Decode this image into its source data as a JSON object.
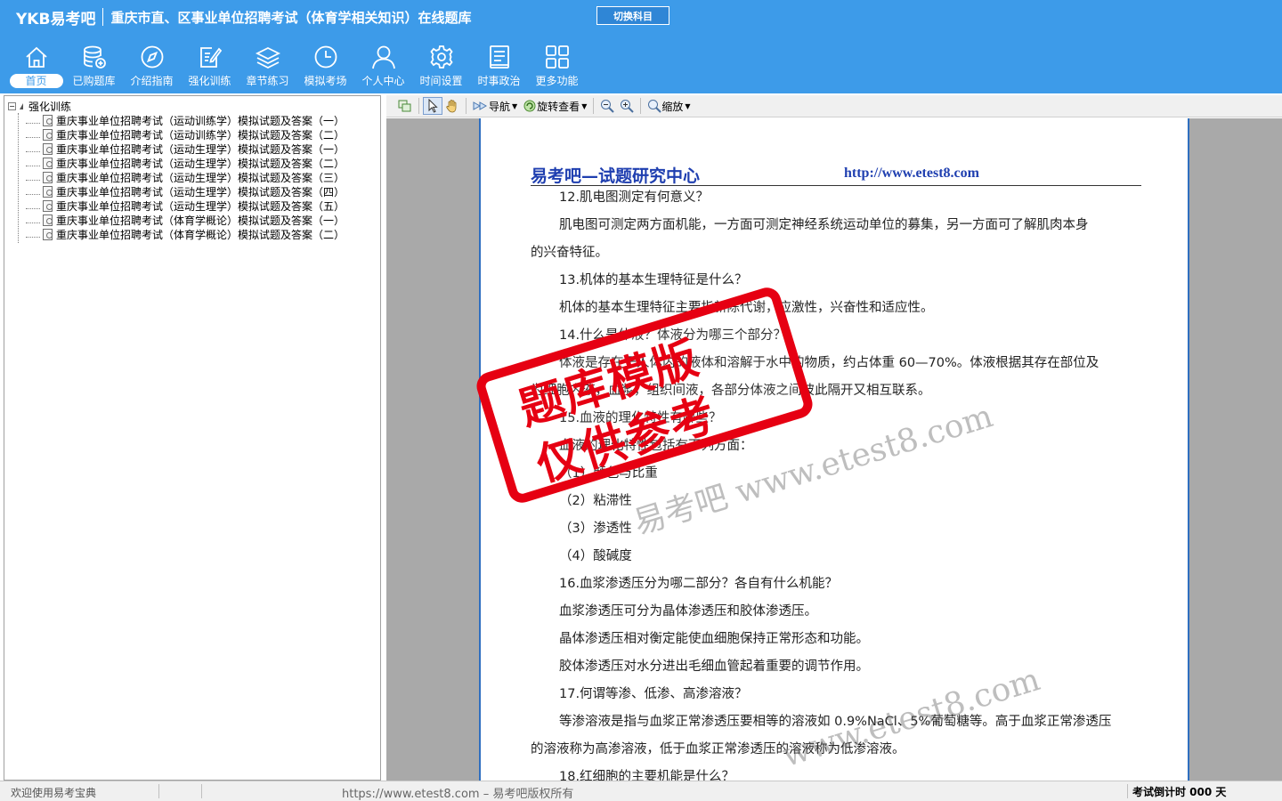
{
  "header": {
    "logo": "YKB易考吧",
    "title": "重庆市直、区事业单位招聘考试（体育学相关知识）在线题库",
    "switch_label": "切换科目"
  },
  "nav": [
    {
      "label": "首页",
      "icon": "home-icon"
    },
    {
      "label": "已购题库",
      "icon": "database-icon"
    },
    {
      "label": "介绍指南",
      "icon": "compass-icon"
    },
    {
      "label": "强化训练",
      "icon": "edit-icon"
    },
    {
      "label": "章节练习",
      "icon": "layers-icon"
    },
    {
      "label": "模拟考场",
      "icon": "clock-icon"
    },
    {
      "label": "个人中心",
      "icon": "user-icon"
    },
    {
      "label": "时间设置",
      "icon": "gear-icon"
    },
    {
      "label": "时事政治",
      "icon": "news-icon"
    },
    {
      "label": "更多功能",
      "icon": "grid-icon"
    }
  ],
  "tree": {
    "root": "强化训练",
    "items": [
      "重庆事业单位招聘考试（运动训练学）模拟试题及答案（一）",
      "重庆事业单位招聘考试（运动训练学）模拟试题及答案（二）",
      "重庆事业单位招聘考试（运动生理学）模拟试题及答案（一）",
      "重庆事业单位招聘考试（运动生理学）模拟试题及答案（二）",
      "重庆事业单位招聘考试（运动生理学）模拟试题及答案（三）",
      "重庆事业单位招聘考试（运动生理学）模拟试题及答案（四）",
      "重庆事业单位招聘考试（运动生理学）模拟试题及答案（五）",
      "重庆事业单位招聘考试（体育学概论）模拟试题及答案（一）",
      "重庆事业单位招聘考试（体育学概论）模拟试题及答案（二）"
    ]
  },
  "toolbar": {
    "nav_label": "导航",
    "rotate_label": "旋转查看",
    "zoom_label": "缩放"
  },
  "document": {
    "header_left": "易考吧—试题研究中心",
    "header_right": "http://www.etest8.com",
    "lines": [
      {
        "text": "12.肌电图测定有何意义？",
        "indent": true
      },
      {
        "text": "肌电图可测定两方面机能，一方面可测定神经系统运动单位的募集，另一方面可了解肌肉本身",
        "indent": true
      },
      {
        "text": "的兴奋特征。",
        "indent": false
      },
      {
        "text": "13.机体的基本生理特征是什么？",
        "indent": true
      },
      {
        "text": "机体的基本生理特征主要指新陈代谢，应激性，兴奋性和适应性。",
        "indent": true
      },
      {
        "text": "14.什么是体液？体液分为哪三个部分？",
        "indent": true
      },
      {
        "text": "体液是存在于人体内的液体和溶解于水中的物质，约占体重 60—70%。体液根据其存在部位及",
        "indent": true
      },
      {
        "text": "为细胞内液，血浆，组织间液，各部分体液之间彼此隔开又相互联系。",
        "indent": false
      },
      {
        "text": "15.血液的理化特性有哪些？",
        "indent": true
      },
      {
        "text": "血液的理化特性包括有下列方面：",
        "indent": true
      },
      {
        "text": "（1）颜色与比重",
        "indent": true
      },
      {
        "text": "（2）粘滞性",
        "indent": true
      },
      {
        "text": "（3）渗透性",
        "indent": true
      },
      {
        "text": "（4）酸碱度",
        "indent": true
      },
      {
        "text": "16.血浆渗透压分为哪二部分？各自有什么机能？",
        "indent": true
      },
      {
        "text": "血浆渗透压可分为晶体渗透压和胶体渗透压。",
        "indent": true
      },
      {
        "text": "晶体渗透压相对衡定能使血细胞保持正常形态和功能。",
        "indent": true
      },
      {
        "text": "胶体渗透压对水分进出毛细血管起着重要的调节作用。",
        "indent": true
      },
      {
        "text": "17.何谓等渗、低渗、高渗溶液？",
        "indent": true
      },
      {
        "text": "等渗溶液是指与血浆正常渗透压要相等的溶液如 0.9%NaCl、5%葡萄糖等。高于血浆正常渗透压",
        "indent": true
      },
      {
        "text": "的溶液称为高渗溶液，低于血浆正常渗透压的溶液称为低渗溶液。",
        "indent": false
      },
      {
        "text": "18.红细胞的主要机能是什么？",
        "indent": true
      }
    ]
  },
  "watermark": {
    "stamp_line1": "题库模版",
    "stamp_line2": "仅供参考",
    "site_text_1": "易考吧 www.etest8.com",
    "site_text_2": "www.etest8.com"
  },
  "status": {
    "welcome": "欢迎使用易考宝典",
    "copyright": "https://www.etest8.com – 易考吧版权所有",
    "countdown": "考试倒计时 000 天"
  },
  "colors": {
    "header_blue": "#3d9be9",
    "stamp_red": "#e60012",
    "doc_header_blue": "#1f3fb0"
  }
}
